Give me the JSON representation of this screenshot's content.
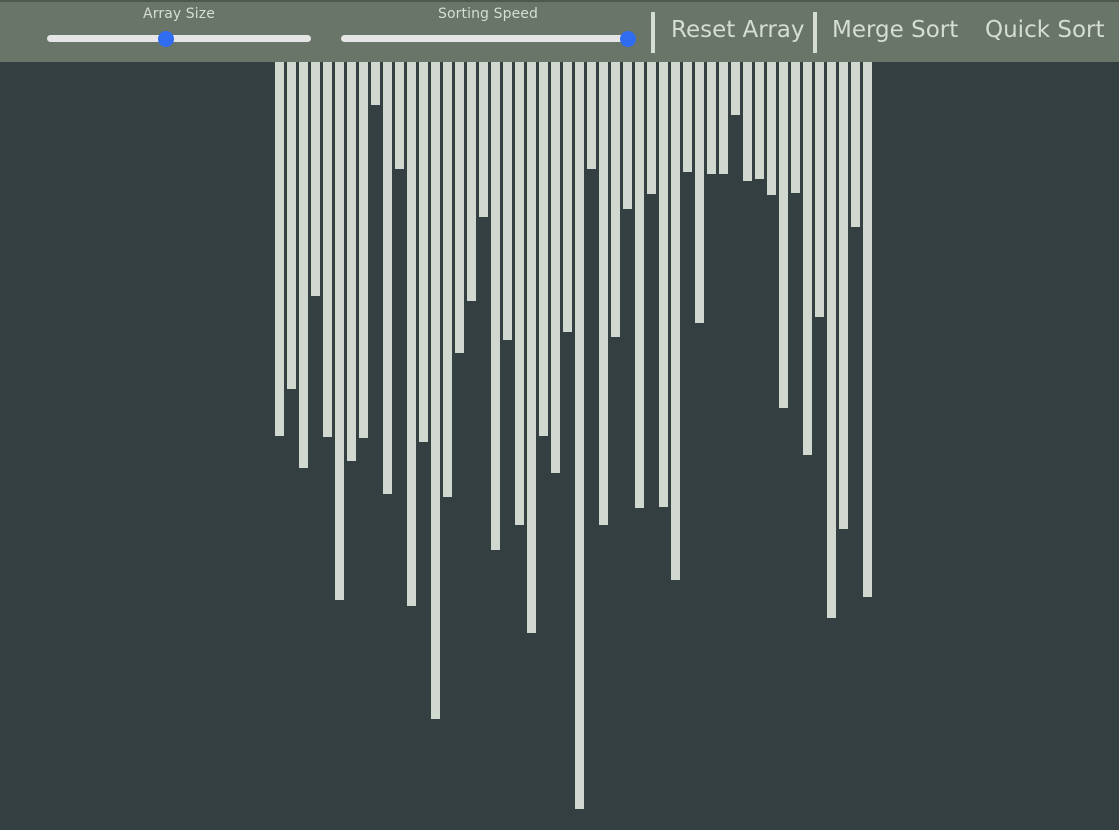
{
  "toolbar": {
    "array_size": {
      "label": "Array Size",
      "value_fraction": 0.45
    },
    "sorting_speed": {
      "label": "Sorting Speed",
      "value_fraction": 1.0
    },
    "reset_label": "Reset Array",
    "merge_label": "Merge Sort",
    "quick_label": "Quick Sort",
    "thumb_color": "#2f6cf0"
  },
  "array": {
    "bar_color": "#d0d8cf",
    "values": [
      374,
      327,
      406,
      234,
      375,
      538,
      399,
      376,
      43,
      432,
      107,
      544,
      380,
      657,
      435,
      291,
      239,
      155,
      488,
      278,
      463,
      571,
      374,
      411,
      270,
      747,
      107,
      463,
      275,
      147,
      446,
      132,
      445,
      518,
      110,
      261,
      112,
      112,
      53,
      119,
      117,
      133,
      346,
      131,
      393,
      255,
      556,
      467,
      165,
      535
    ]
  }
}
